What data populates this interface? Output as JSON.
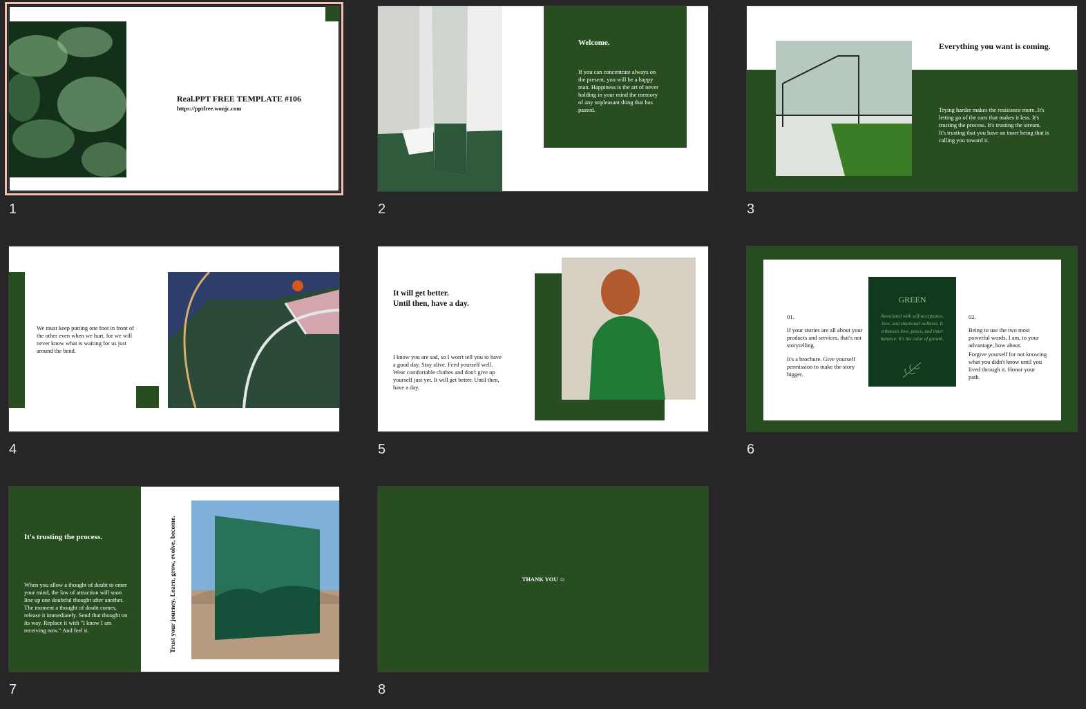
{
  "colors": {
    "background": "#262626",
    "slide_green": "#274d21",
    "selection_outline": "#f3c0b2"
  },
  "slides": [
    {
      "number": "1",
      "title": "Real.PPT FREE TEMPLATE #106",
      "url": "https://pptfree.wonjc.com",
      "selected": true
    },
    {
      "number": "2",
      "heading": "Welcome.",
      "body": "If you can concentrate always on the present, you will be a happy man. Happiness is the art of never holding in your mind the memory of any unpleasant thing that has passed."
    },
    {
      "number": "3",
      "heading": "Everything you want is coming.",
      "body": "Trying harder makes the resistance more. It's letting go of the oars that makes it less. It's trusting the process. It's trusting the stream. It's trusting that you have an inner being that is calling you toward it."
    },
    {
      "number": "4",
      "body": "We must keep putting one foot in front of the other even when we hurt, for we will never know what is waiting for us just around the bend."
    },
    {
      "number": "5",
      "heading_line1": "It will get better.",
      "heading_line2": "Until then, have a day.",
      "body": "I know you are sad, so I won't tell you to have a good day. Stay alive. Feed yourself well. Wear comfortable clothes and don't give up yourself just yet. It will get better. Until then, have a day."
    },
    {
      "number": "6",
      "left_index": "01.",
      "left_p1": "If your stories are all about your products and services, that's not storytelling.",
      "left_p2": "It's a brochure. Give yourself permission to make the story bigger.",
      "card_title": "GREEN",
      "card_body": "Associated with self-acceptance, love, and emotional wellness. It enhances love, peace, and inner balance. It's the color of growth.",
      "right_index": "02.",
      "right_p1": "Being to use the two most powerful words, I am, to your advantage, how about.",
      "right_p2": "Forgive yourself for not knowing what you didn't know until you lived through it. Honor your path."
    },
    {
      "number": "7",
      "heading": "It's trusting the process.",
      "body": "When you allow a thought of doubt to enter your mind, the law of attraction will soon line up one doubtful thought after another. The moment a thought of doubt comes, release it immediately. Send that thought on its way. Replace it with \"I know I am receiving now.\" And feel it.",
      "vertical": "Trust your journey. Learn, grow, evolve, become."
    },
    {
      "number": "8",
      "text": "THANK YOU ☺"
    }
  ]
}
